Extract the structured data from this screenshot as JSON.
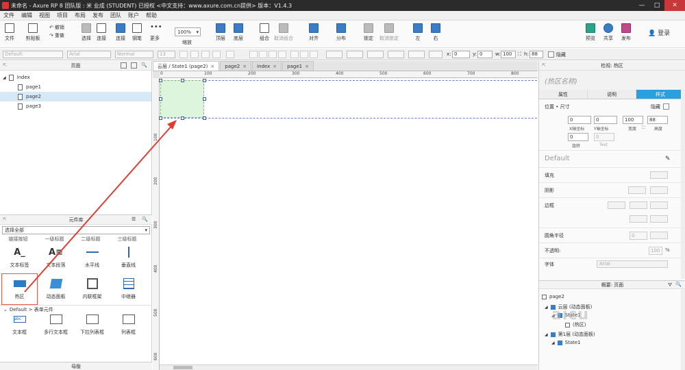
{
  "window": {
    "title": "未命名 - Axure RP 8 团队版 : 米 业成 (STUDENT) 已授权    <中文支持：www.axure.com.cn提供> 版本：V1.4.3",
    "minimize": "—",
    "maximize": "□",
    "close": "✕"
  },
  "menu": [
    "文件",
    "编辑",
    "视图",
    "项目",
    "布局",
    "发布",
    "团队",
    "账户",
    "帮助"
  ],
  "toolbar": {
    "file": "文件",
    "clipboard": "剪贴板",
    "undo": "撤销",
    "redo": "重做",
    "select": "选择",
    "connect": "连接",
    "pen": "钢笔",
    "more": "更多",
    "zoom_value": "100%",
    "zoom_label": "缩放",
    "top_layer": "顶层",
    "bottom_layer": "底层",
    "group": "组合",
    "ungroup": "取消组合",
    "align": "对齐",
    "distribute": "分布",
    "lock": "锁定",
    "unlock": "取消锁定",
    "left": "左",
    "right": "右",
    "preview": "预览",
    "share": "共享",
    "publish": "发布",
    "login": "登录"
  },
  "format": {
    "style": "Default",
    "font": "Arial",
    "weight": "Normal",
    "size": "13",
    "x_label": "x:",
    "x": "0",
    "y_label": "y:",
    "y": "0",
    "w_label": "w:",
    "w": "100",
    "h_label": "h:",
    "h": "88",
    "hidden_label": "隐藏"
  },
  "pages_panel": {
    "title": "页面",
    "items": [
      {
        "label": "index",
        "level": 0
      },
      {
        "label": "page1",
        "level": 1
      },
      {
        "label": "page2",
        "level": 1,
        "selected": true
      },
      {
        "label": "page3",
        "level": 1
      }
    ]
  },
  "library": {
    "title": "元件库",
    "select_value": "选择全部",
    "cut_row": [
      "链接按钮",
      "一级标题",
      "二级标题",
      "三级标题"
    ],
    "row1": [
      "文本标签",
      "文本段落",
      "水平线",
      "垂直线"
    ],
    "row2": [
      "热区",
      "动态面板",
      "内联框架",
      "中继器"
    ],
    "subsection": "Default > 表单元件",
    "row3": [
      "文本框",
      "多行文本框",
      "下拉列表框",
      "列表框"
    ],
    "masters_title": "母版"
  },
  "tabs": [
    {
      "label": "云层 / State1 (page2)",
      "active": true
    },
    {
      "label": "page2"
    },
    {
      "label": "index"
    },
    {
      "label": "page1"
    }
  ],
  "ruler": {
    "top": [
      "0",
      "100",
      "200",
      "300",
      "400",
      "500",
      "600",
      "700",
      "800"
    ],
    "left": [
      "100",
      "200",
      "300",
      "400",
      "500",
      "600"
    ]
  },
  "inspector": {
    "header": "检视: 热区",
    "name_placeholder": "(热区名称)",
    "tabs": [
      "属性",
      "说明",
      "样式"
    ],
    "pos_size": "位置 • 尺寸",
    "hidden": "隐藏",
    "x": "0",
    "y": "0",
    "w": "100",
    "h": "88",
    "x_label": "X轴坐标",
    "y_label": "Y轴坐标",
    "w_label": "宽度",
    "h_label": "高度",
    "rotate": "0",
    "rotate_label": "旋转",
    "text_rotate": "0",
    "text_label": "Text",
    "style_name": "Default",
    "fill": "填充",
    "shadow": "阴影",
    "border": "边框",
    "radius": "圆角半径",
    "radius_value": "0",
    "opacity": "不透明:",
    "opacity_value": "100",
    "opacity_unit": "%",
    "font": "字体",
    "font_value": "Arial"
  },
  "outline": {
    "title": "概要: 页面",
    "items": [
      "page2",
      "云层 (动态面板)",
      "State1",
      "(热区)",
      "第1层 (动态面板)",
      "State1"
    ]
  },
  "watermark": "aicu"
}
